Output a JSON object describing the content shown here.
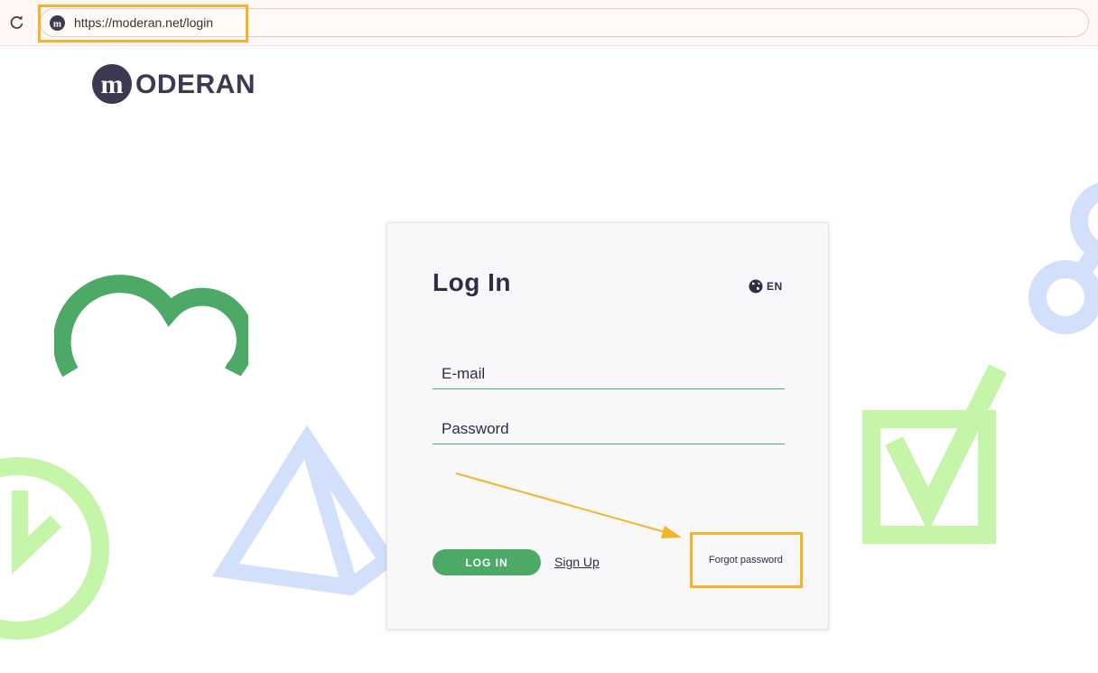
{
  "browser": {
    "url": "https://moderan.net/login",
    "reload_icon": "reload-icon",
    "favicon_icon": "moderan-favicon-icon"
  },
  "logo": {
    "text": "ODERAN",
    "mark_letter": "m"
  },
  "login": {
    "title": "Log In",
    "language": "EN",
    "language_icon": "globe-icon",
    "email_placeholder": "E-mail",
    "password_placeholder": "Password",
    "login_button": "LOG IN",
    "signup_link": "Sign Up",
    "forgot_link": "Forgot password"
  },
  "colors": {
    "brand_dark": "#3c3a52",
    "accent_green": "#4caa66",
    "annotation": "#f1b52a",
    "light_green": "#c5f5a8",
    "light_blue": "#d3e0fb"
  }
}
